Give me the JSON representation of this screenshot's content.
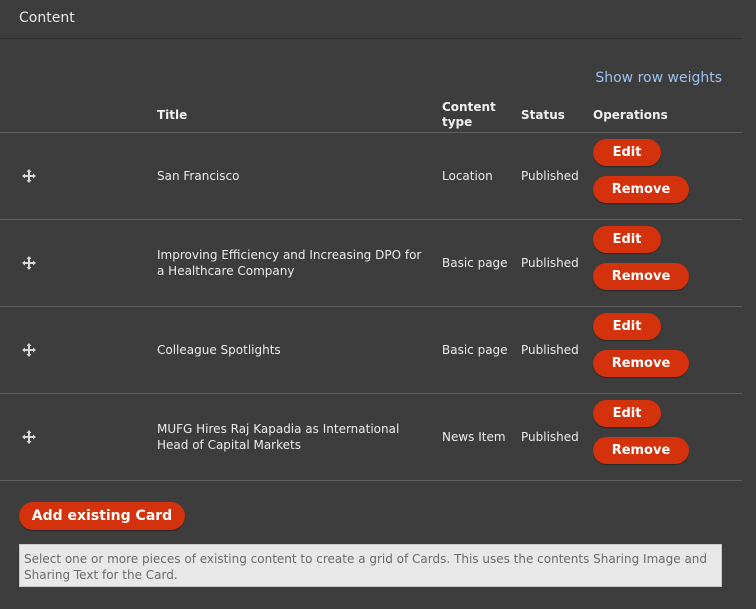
{
  "section": {
    "title": "Content"
  },
  "show_row_weights": "Show row weights",
  "table": {
    "headers": {
      "title": "Title",
      "content_type": "Content type",
      "status": "Status",
      "operations": "Operations"
    },
    "rows": [
      {
        "title": "San Francisco",
        "type": "Location",
        "status": "Published",
        "edit": "Edit",
        "remove": "Remove"
      },
      {
        "title": "Improving Efficiency and Increasing DPO for a Healthcare Company",
        "type": "Basic page",
        "status": "Published",
        "edit": "Edit",
        "remove": "Remove"
      },
      {
        "title": "Colleague Spotlights",
        "type": "Basic page",
        "status": "Published",
        "edit": "Edit",
        "remove": "Remove"
      },
      {
        "title": "MUFG Hires Raj Kapadia as International Head of Capital Markets",
        "type": "News Item",
        "status": "Published",
        "edit": "Edit",
        "remove": "Remove"
      }
    ]
  },
  "add_button": "Add existing Card",
  "help_text": "Select one or more pieces of existing content to create a grid of Cards. This uses the contents Sharing Image and Sharing Text for the Card.",
  "icons": {
    "drag": "drag-handle-icon"
  },
  "colors": {
    "accent": "#d4320c",
    "link": "#9cc3ee",
    "background": "#3d3d3d"
  }
}
